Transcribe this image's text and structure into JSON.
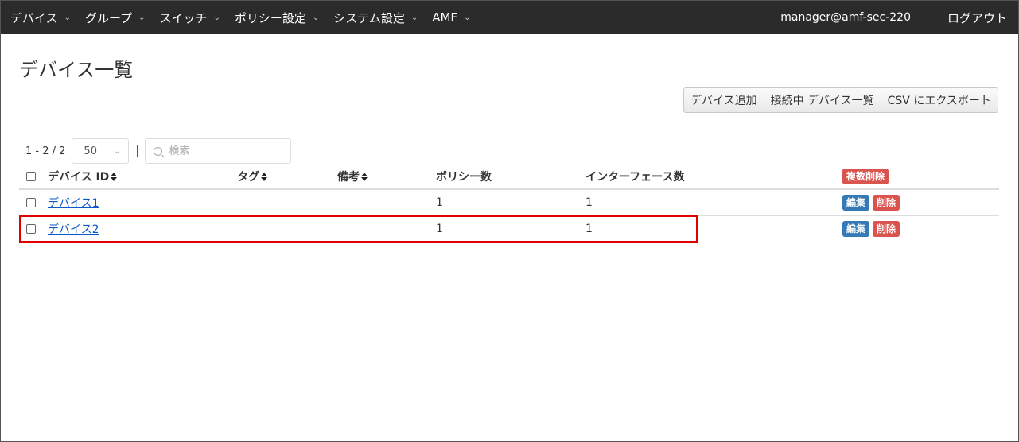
{
  "nav": {
    "items": [
      {
        "label": "デバイス"
      },
      {
        "label": "グループ"
      },
      {
        "label": "スイッチ"
      },
      {
        "label": "ポリシー設定"
      },
      {
        "label": "システム設定"
      },
      {
        "label": "AMF"
      }
    ],
    "user": "manager@amf-sec-220",
    "logout": "ログアウト"
  },
  "page": {
    "title": "デバイス一覧"
  },
  "actions": {
    "add_device": "デバイス追加",
    "connected_list": "接続中 デバイス一覧",
    "csv_export": "CSV にエクスポート"
  },
  "toolbar": {
    "count": "1 - 2 / 2",
    "page_size": "50",
    "search_placeholder": "検索"
  },
  "table": {
    "headers": {
      "device_id": "デバイス ID",
      "tag": "タグ",
      "note": "備考",
      "policy_count": "ポリシー数",
      "interface_count": "インターフェース数",
      "bulk_delete": "複数削除"
    },
    "rows": [
      {
        "device_id": "デバイス1",
        "tag": "",
        "note": "",
        "policy_count": "1",
        "interface_count": "1",
        "edit": "編集",
        "delete": "削除"
      },
      {
        "device_id": "デバイス2",
        "tag": "",
        "note": "",
        "policy_count": "1",
        "interface_count": "1",
        "edit": "編集",
        "delete": "削除"
      }
    ]
  },
  "colors": {
    "navbar_bg": "#2b2b2b",
    "primary_blue": "#337ab7",
    "danger_red": "#d9534f",
    "highlight_red": "#e00000",
    "link": "#0a58ca"
  }
}
